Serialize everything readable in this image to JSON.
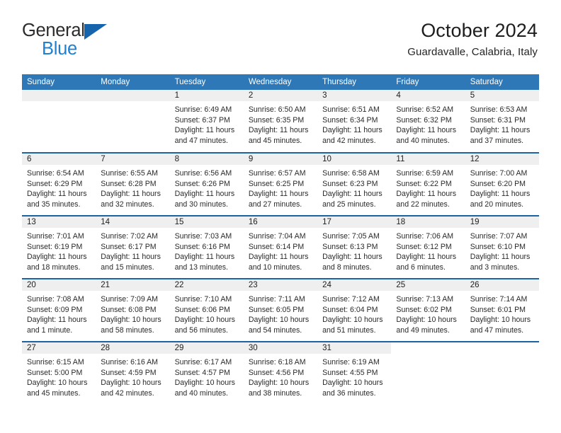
{
  "logo": {
    "line1": "General",
    "line2": "Blue",
    "triangle_icon": "triangle-icon",
    "accent_color": "#1664ac",
    "blue_text_color": "#1f7fd0"
  },
  "header": {
    "title": "October 2024",
    "location": "Guardavalle, Calabria, Italy"
  },
  "theme": {
    "header_row_bg": "#2e78b8",
    "row_divider": "#1c63a4",
    "daynum_band_bg": "#efefef"
  },
  "calendar": {
    "weekday_headers": [
      "Sunday",
      "Monday",
      "Tuesday",
      "Wednesday",
      "Thursday",
      "Friday",
      "Saturday"
    ],
    "weeks": [
      [
        {
          "day": "",
          "sunrise": "",
          "sunset": "",
          "daylight_1": "",
          "daylight_2": "",
          "empty": true
        },
        {
          "day": "",
          "sunrise": "",
          "sunset": "",
          "daylight_1": "",
          "daylight_2": "",
          "empty": true
        },
        {
          "day": "1",
          "sunrise": "Sunrise: 6:49 AM",
          "sunset": "Sunset: 6:37 PM",
          "daylight_1": "Daylight: 11 hours",
          "daylight_2": "and 47 minutes."
        },
        {
          "day": "2",
          "sunrise": "Sunrise: 6:50 AM",
          "sunset": "Sunset: 6:35 PM",
          "daylight_1": "Daylight: 11 hours",
          "daylight_2": "and 45 minutes."
        },
        {
          "day": "3",
          "sunrise": "Sunrise: 6:51 AM",
          "sunset": "Sunset: 6:34 PM",
          "daylight_1": "Daylight: 11 hours",
          "daylight_2": "and 42 minutes."
        },
        {
          "day": "4",
          "sunrise": "Sunrise: 6:52 AM",
          "sunset": "Sunset: 6:32 PM",
          "daylight_1": "Daylight: 11 hours",
          "daylight_2": "and 40 minutes."
        },
        {
          "day": "5",
          "sunrise": "Sunrise: 6:53 AM",
          "sunset": "Sunset: 6:31 PM",
          "daylight_1": "Daylight: 11 hours",
          "daylight_2": "and 37 minutes."
        }
      ],
      [
        {
          "day": "6",
          "sunrise": "Sunrise: 6:54 AM",
          "sunset": "Sunset: 6:29 PM",
          "daylight_1": "Daylight: 11 hours",
          "daylight_2": "and 35 minutes."
        },
        {
          "day": "7",
          "sunrise": "Sunrise: 6:55 AM",
          "sunset": "Sunset: 6:28 PM",
          "daylight_1": "Daylight: 11 hours",
          "daylight_2": "and 32 minutes."
        },
        {
          "day": "8",
          "sunrise": "Sunrise: 6:56 AM",
          "sunset": "Sunset: 6:26 PM",
          "daylight_1": "Daylight: 11 hours",
          "daylight_2": "and 30 minutes."
        },
        {
          "day": "9",
          "sunrise": "Sunrise: 6:57 AM",
          "sunset": "Sunset: 6:25 PM",
          "daylight_1": "Daylight: 11 hours",
          "daylight_2": "and 27 minutes."
        },
        {
          "day": "10",
          "sunrise": "Sunrise: 6:58 AM",
          "sunset": "Sunset: 6:23 PM",
          "daylight_1": "Daylight: 11 hours",
          "daylight_2": "and 25 minutes."
        },
        {
          "day": "11",
          "sunrise": "Sunrise: 6:59 AM",
          "sunset": "Sunset: 6:22 PM",
          "daylight_1": "Daylight: 11 hours",
          "daylight_2": "and 22 minutes."
        },
        {
          "day": "12",
          "sunrise": "Sunrise: 7:00 AM",
          "sunset": "Sunset: 6:20 PM",
          "daylight_1": "Daylight: 11 hours",
          "daylight_2": "and 20 minutes."
        }
      ],
      [
        {
          "day": "13",
          "sunrise": "Sunrise: 7:01 AM",
          "sunset": "Sunset: 6:19 PM",
          "daylight_1": "Daylight: 11 hours",
          "daylight_2": "and 18 minutes."
        },
        {
          "day": "14",
          "sunrise": "Sunrise: 7:02 AM",
          "sunset": "Sunset: 6:17 PM",
          "daylight_1": "Daylight: 11 hours",
          "daylight_2": "and 15 minutes."
        },
        {
          "day": "15",
          "sunrise": "Sunrise: 7:03 AM",
          "sunset": "Sunset: 6:16 PM",
          "daylight_1": "Daylight: 11 hours",
          "daylight_2": "and 13 minutes."
        },
        {
          "day": "16",
          "sunrise": "Sunrise: 7:04 AM",
          "sunset": "Sunset: 6:14 PM",
          "daylight_1": "Daylight: 11 hours",
          "daylight_2": "and 10 minutes."
        },
        {
          "day": "17",
          "sunrise": "Sunrise: 7:05 AM",
          "sunset": "Sunset: 6:13 PM",
          "daylight_1": "Daylight: 11 hours",
          "daylight_2": "and 8 minutes."
        },
        {
          "day": "18",
          "sunrise": "Sunrise: 7:06 AM",
          "sunset": "Sunset: 6:12 PM",
          "daylight_1": "Daylight: 11 hours",
          "daylight_2": "and 6 minutes."
        },
        {
          "day": "19",
          "sunrise": "Sunrise: 7:07 AM",
          "sunset": "Sunset: 6:10 PM",
          "daylight_1": "Daylight: 11 hours",
          "daylight_2": "and 3 minutes."
        }
      ],
      [
        {
          "day": "20",
          "sunrise": "Sunrise: 7:08 AM",
          "sunset": "Sunset: 6:09 PM",
          "daylight_1": "Daylight: 11 hours",
          "daylight_2": "and 1 minute."
        },
        {
          "day": "21",
          "sunrise": "Sunrise: 7:09 AM",
          "sunset": "Sunset: 6:08 PM",
          "daylight_1": "Daylight: 10 hours",
          "daylight_2": "and 58 minutes."
        },
        {
          "day": "22",
          "sunrise": "Sunrise: 7:10 AM",
          "sunset": "Sunset: 6:06 PM",
          "daylight_1": "Daylight: 10 hours",
          "daylight_2": "and 56 minutes."
        },
        {
          "day": "23",
          "sunrise": "Sunrise: 7:11 AM",
          "sunset": "Sunset: 6:05 PM",
          "daylight_1": "Daylight: 10 hours",
          "daylight_2": "and 54 minutes."
        },
        {
          "day": "24",
          "sunrise": "Sunrise: 7:12 AM",
          "sunset": "Sunset: 6:04 PM",
          "daylight_1": "Daylight: 10 hours",
          "daylight_2": "and 51 minutes."
        },
        {
          "day": "25",
          "sunrise": "Sunrise: 7:13 AM",
          "sunset": "Sunset: 6:02 PM",
          "daylight_1": "Daylight: 10 hours",
          "daylight_2": "and 49 minutes."
        },
        {
          "day": "26",
          "sunrise": "Sunrise: 7:14 AM",
          "sunset": "Sunset: 6:01 PM",
          "daylight_1": "Daylight: 10 hours",
          "daylight_2": "and 47 minutes."
        }
      ],
      [
        {
          "day": "27",
          "sunrise": "Sunrise: 6:15 AM",
          "sunset": "Sunset: 5:00 PM",
          "daylight_1": "Daylight: 10 hours",
          "daylight_2": "and 45 minutes."
        },
        {
          "day": "28",
          "sunrise": "Sunrise: 6:16 AM",
          "sunset": "Sunset: 4:59 PM",
          "daylight_1": "Daylight: 10 hours",
          "daylight_2": "and 42 minutes."
        },
        {
          "day": "29",
          "sunrise": "Sunrise: 6:17 AM",
          "sunset": "Sunset: 4:57 PM",
          "daylight_1": "Daylight: 10 hours",
          "daylight_2": "and 40 minutes."
        },
        {
          "day": "30",
          "sunrise": "Sunrise: 6:18 AM",
          "sunset": "Sunset: 4:56 PM",
          "daylight_1": "Daylight: 10 hours",
          "daylight_2": "and 38 minutes."
        },
        {
          "day": "31",
          "sunrise": "Sunrise: 6:19 AM",
          "sunset": "Sunset: 4:55 PM",
          "daylight_1": "Daylight: 10 hours",
          "daylight_2": "and 36 minutes."
        },
        {
          "day": "",
          "sunrise": "",
          "sunset": "",
          "daylight_1": "",
          "daylight_2": "",
          "blank": true
        },
        {
          "day": "",
          "sunrise": "",
          "sunset": "",
          "daylight_1": "",
          "daylight_2": "",
          "blank": true
        }
      ]
    ]
  }
}
